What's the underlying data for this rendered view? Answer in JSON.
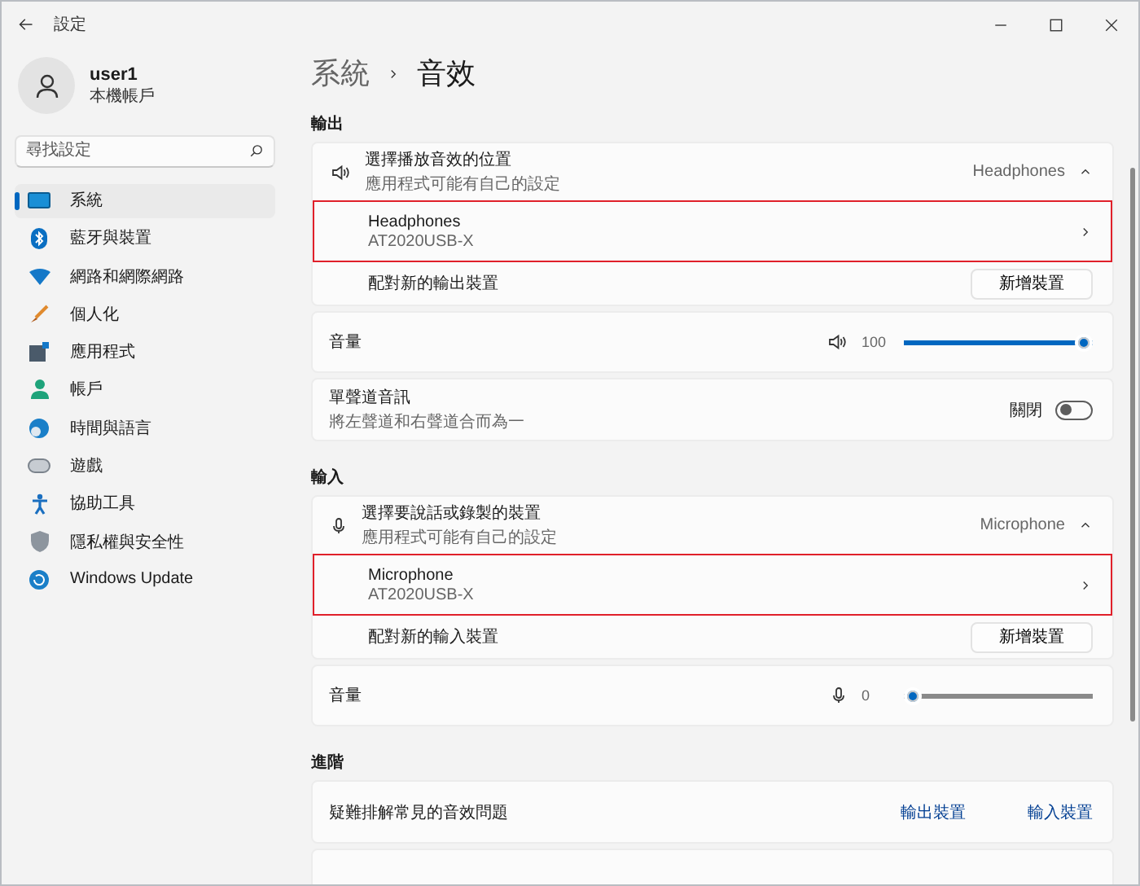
{
  "window": {
    "title": "設定"
  },
  "user": {
    "name": "user1",
    "account": "本機帳戶"
  },
  "search": {
    "placeholder": "尋找設定"
  },
  "nav": [
    {
      "label": "系統",
      "selected": true
    },
    {
      "label": "藍牙與裝置",
      "selected": false
    },
    {
      "label": "網路和網際網路",
      "selected": false
    },
    {
      "label": "個人化",
      "selected": false
    },
    {
      "label": "應用程式",
      "selected": false
    },
    {
      "label": "帳戶",
      "selected": false
    },
    {
      "label": "時間與語言",
      "selected": false
    },
    {
      "label": "遊戲",
      "selected": false
    },
    {
      "label": "協助工具",
      "selected": false
    },
    {
      "label": "隱私權與安全性",
      "selected": false
    },
    {
      "label": "Windows Update",
      "selected": false
    }
  ],
  "breadcrumb": [
    "系統",
    "音效"
  ],
  "sections": [
    {
      "heading": "輸出",
      "kind": "output",
      "groups": [
        {
          "kind": "picker",
          "title": "選擇播放音效的位置",
          "subtitle": "應用程式可能有自己的設定",
          "current": "Headphones",
          "expanded": true,
          "device": {
            "name": "Headphones",
            "detail": "AT2020USB-X",
            "highlighted": true
          },
          "pair": {
            "label": "配對新的輸出裝置",
            "button": "新增裝置"
          }
        },
        {
          "kind": "volume",
          "label": "音量",
          "reading": "100",
          "level": 1
        },
        {
          "kind": "toggle",
          "title": "單聲道音訊",
          "subtitle": "將左聲道和右聲道合而為一",
          "state_label": "關閉",
          "on": false
        }
      ]
    },
    {
      "heading": "輸入",
      "kind": "input",
      "groups": [
        {
          "kind": "picker",
          "title": "選擇要說話或錄製的裝置",
          "subtitle": "應用程式可能有自己的設定",
          "current": "Microphone",
          "expanded": true,
          "device": {
            "name": "Microphone",
            "detail": "AT2020USB-X",
            "highlighted": true
          },
          "pair": {
            "label": "配對新的輸入裝置",
            "button": "新增裝置"
          }
        },
        {
          "kind": "volume",
          "label": "音量",
          "reading": "0",
          "level": 0
        }
      ]
    },
    {
      "heading": "進階",
      "kind": "advanced",
      "groups": [
        {
          "kind": "links",
          "label": "疑難排解常見的音效問題",
          "links": [
            "輸出裝置",
            "輸入裝置"
          ]
        },
        {
          "kind": "stub"
        }
      ]
    }
  ]
}
